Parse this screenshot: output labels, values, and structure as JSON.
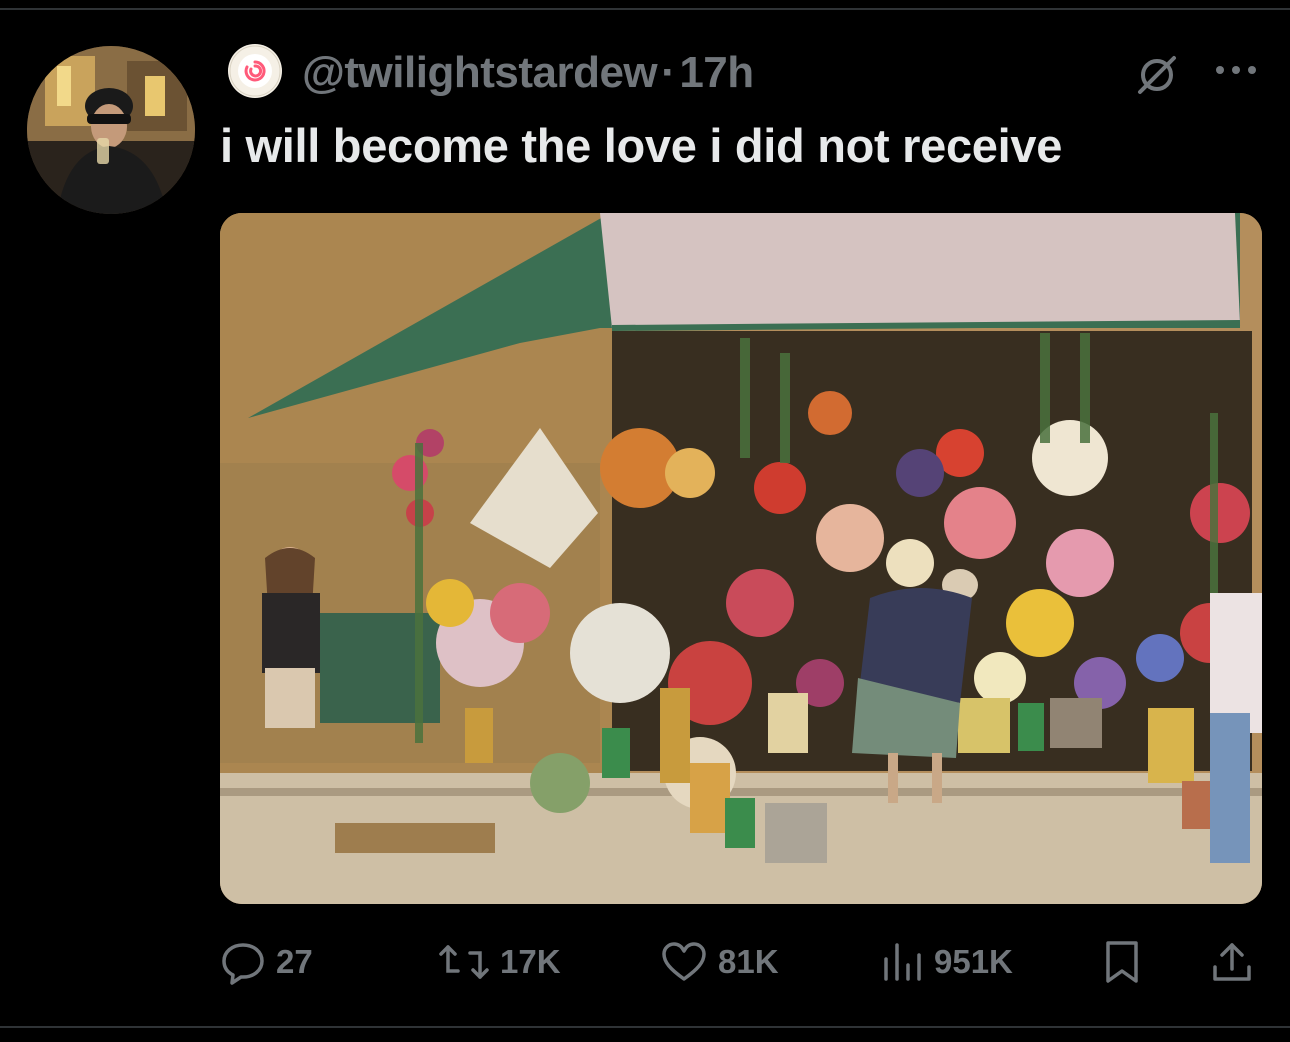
{
  "post": {
    "handle": "@twilightstardew",
    "separator": "·",
    "time": "17h",
    "text": "i will become the love i did not receive"
  },
  "media": {
    "description_icon": "photo-flower-stall"
  },
  "actions": {
    "replies": "27",
    "reposts": "17K",
    "likes": "81K",
    "views": "951K"
  },
  "icons": {
    "reply": "reply-icon",
    "repost": "repost-icon",
    "like": "heart-icon",
    "views": "views-icon",
    "bookmark": "bookmark-icon",
    "share": "share-icon",
    "grok": "grok-icon",
    "more": "more-icon"
  },
  "colors": {
    "background": "#000000",
    "text_primary": "#e7e9ea",
    "text_secondary": "#71767b",
    "divider": "#2f3336"
  }
}
